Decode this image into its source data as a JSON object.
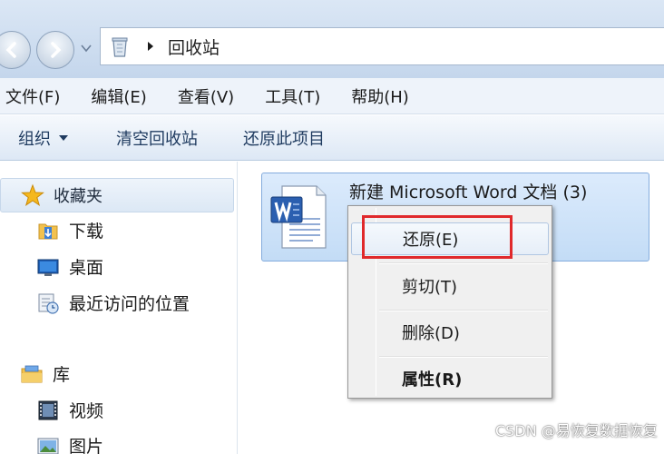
{
  "address": {
    "crumb": "回收站"
  },
  "menu": [
    {
      "label": "文件(F)"
    },
    {
      "label": "编辑(E)"
    },
    {
      "label": "查看(V)"
    },
    {
      "label": "工具(T)"
    },
    {
      "label": "帮助(H)"
    }
  ],
  "toolbar": {
    "organize": "组织",
    "empty_bin": "清空回收站",
    "restore_item": "还原此项目"
  },
  "nav": {
    "favorites": "收藏夹",
    "downloads": "下载",
    "desktop": "桌面",
    "recent": "最近访问的位置",
    "libraries": "库",
    "videos": "视频",
    "pictures": "图片"
  },
  "file": {
    "name": "新建 Microsoft Word 文档 (3)",
    "type": "Microsoft Word 文档"
  },
  "context_menu": {
    "restore": "还原(E)",
    "cut": "剪切(T)",
    "delete": "删除(D)",
    "properties": "属性(R)"
  },
  "watermark": "CSDN @易恢复数据恢复",
  "colors": {
    "highlight": "#e0292b",
    "selection": "#c3dcf6"
  }
}
